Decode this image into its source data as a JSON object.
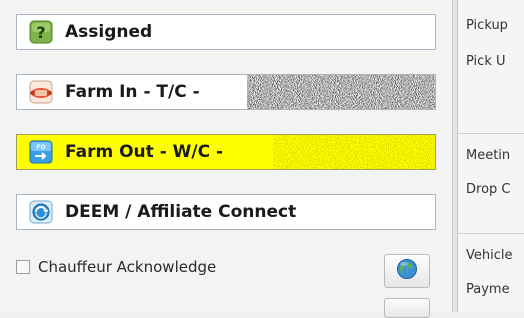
{
  "status_buttons": [
    {
      "label": "Assigned",
      "icon": "question-icon",
      "active": false
    },
    {
      "label": "Farm In - T/C -",
      "icon": "handshake-icon",
      "active": false
    },
    {
      "label": "Farm Out - W/C -",
      "icon": "farm-out-icon",
      "active": true
    },
    {
      "label": "DEEM / Affiliate Connect",
      "icon": "connect-icon",
      "active": false
    }
  ],
  "acknowledge": {
    "label": "Chauffeur Acknowledge",
    "checked": false
  },
  "globe_button": {
    "icon": "globe-icon"
  },
  "right_fields": [
    "Pickup",
    "Pick U",
    "Meetin",
    "Drop C",
    "Vehicle",
    "Payme"
  ],
  "colors": {
    "active_highlight": "#ffff00",
    "border": "#a9b4c3",
    "background": "#f3f3f3"
  }
}
